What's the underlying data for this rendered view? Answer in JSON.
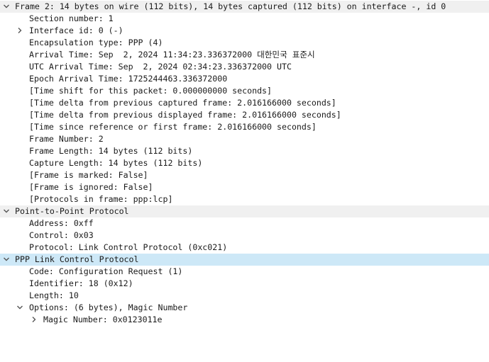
{
  "frame_section": {
    "header": "Frame 2: 14 bytes on wire (112 bits), 14 bytes captured (112 bits) on interface -, id 0",
    "section_number": "Section number: 1",
    "interface_id": "Interface id: 0 (-)",
    "encapsulation_type": "Encapsulation type: PPP (4)",
    "arrival_time": "Arrival Time: Sep  2, 2024 11:34:23.336372000 대한민국 표준시",
    "utc_arrival_time": "UTC Arrival Time: Sep  2, 2024 02:34:23.336372000 UTC",
    "epoch_arrival_time": "Epoch Arrival Time: 1725244463.336372000",
    "time_shift": "[Time shift for this packet: 0.000000000 seconds]",
    "time_delta_captured": "[Time delta from previous captured frame: 2.016166000 seconds]",
    "time_delta_displayed": "[Time delta from previous displayed frame: 2.016166000 seconds]",
    "time_since_reference": "[Time since reference or first frame: 2.016166000 seconds]",
    "frame_number": "Frame Number: 2",
    "frame_length": "Frame Length: 14 bytes (112 bits)",
    "capture_length": "Capture Length: 14 bytes (112 bits)",
    "frame_is_marked": "[Frame is marked: False]",
    "frame_is_ignored": "[Frame is ignored: False]",
    "protocols_in_frame": "[Protocols in frame: ppp:lcp]"
  },
  "ppp_section": {
    "header": "Point-to-Point Protocol",
    "address": "Address: 0xff",
    "control": "Control: 0x03",
    "protocol": "Protocol: Link Control Protocol (0xc021)"
  },
  "lcp_section": {
    "header": "PPP Link Control Protocol",
    "code": "Code: Configuration Request (1)",
    "identifier": "Identifier: 18 (0x12)",
    "length": "Length: 10",
    "options": "Options: (6 bytes), Magic Number",
    "magic_number": "Magic Number: 0x0123011e"
  },
  "colors": {
    "header_bg": "#f0f0f0",
    "selected_bg": "#cde8f7",
    "text": "#1a1a1a"
  }
}
